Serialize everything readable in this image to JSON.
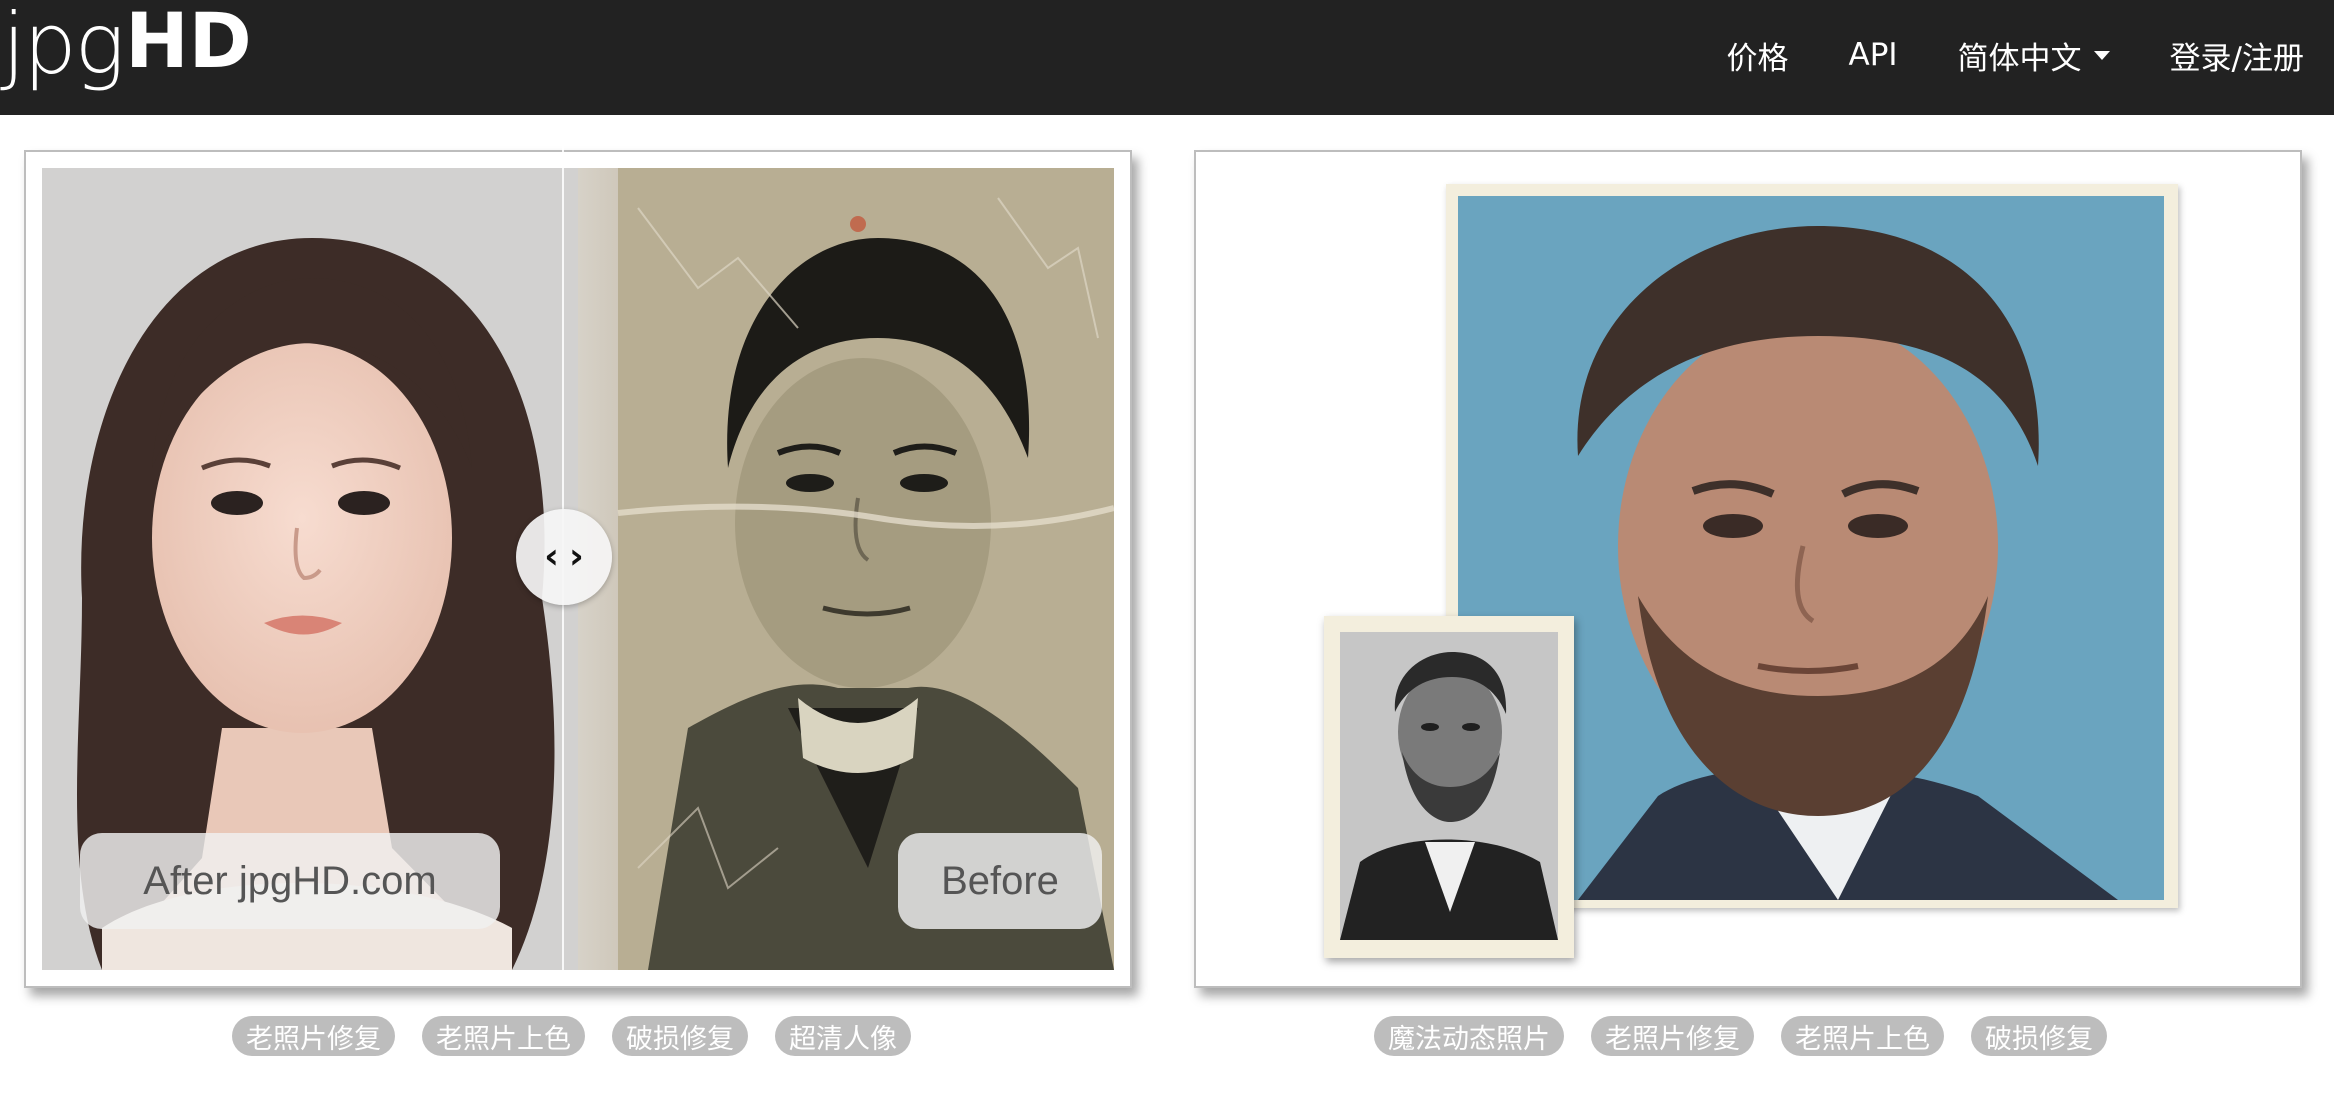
{
  "header": {
    "logo_light": "jpg",
    "logo_bold": "HD",
    "nav": {
      "pricing": "价格",
      "api": "API",
      "language": "简体中文",
      "login": "登录/注册"
    }
  },
  "showcase_left": {
    "after_label": "After jpgHD.com",
    "before_label": "Before",
    "handle_left_icon": "chevron-left-icon",
    "handle_right_icon": "chevron-right-icon",
    "tags": [
      "老照片修复",
      "老照片上色",
      "破损修复",
      "超清人像"
    ]
  },
  "showcase_right": {
    "tags": [
      "魔法动态照片",
      "老照片修复",
      "老照片上色",
      "破损修复"
    ]
  },
  "colors": {
    "header_bg": "#222222",
    "tag_bg": "#bdbdbd",
    "card_border": "#bdbdbd"
  }
}
